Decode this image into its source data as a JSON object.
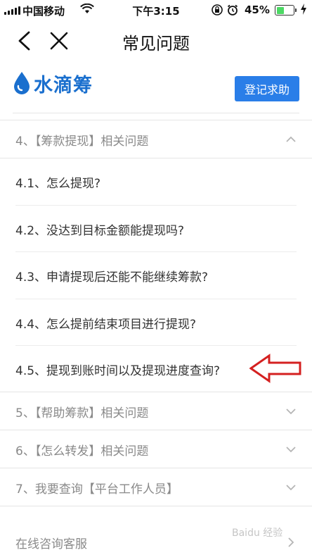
{
  "status_bar": {
    "carrier": "中国移动",
    "time": "下午3:15",
    "battery_percent": "45%",
    "battery_level": 0.45,
    "battery_color": "#4cd964",
    "icons": [
      "signal-icon",
      "wifi-icon",
      "orientation-lock-icon",
      "alarm-icon",
      "battery-icon",
      "charging-icon"
    ]
  },
  "nav": {
    "title": "常见问题",
    "icons": [
      "back-icon",
      "close-icon"
    ]
  },
  "header": {
    "logo_text": "水滴筹",
    "register_label": "登记求助",
    "brand_color": "#1a6fce",
    "button_color": "#2a7ee8"
  },
  "faq": {
    "section4": {
      "title": "4、【筹款提现】相关问题",
      "expanded": true,
      "items": [
        "4.1、怎么提现?",
        "4.2、没达到目标金额能提现吗?",
        "4.3、申请提现后还能不能继续筹款?",
        "4.4、怎么提前结束项目进行提现?",
        "4.5、提现到账时间以及提现进度查询?"
      ]
    },
    "section5": {
      "title": "5、【帮助筹款】相关问题",
      "expanded": false
    },
    "section6": {
      "title": "6、【怎么转发】相关问题",
      "expanded": false
    },
    "section7": {
      "title": "7、我要查询【平台工作人员】",
      "expanded": false
    },
    "online": {
      "title": "在线咨询客服"
    }
  },
  "annotation": {
    "arrow_color": "#d42020"
  },
  "watermark": "Baidu 经验"
}
